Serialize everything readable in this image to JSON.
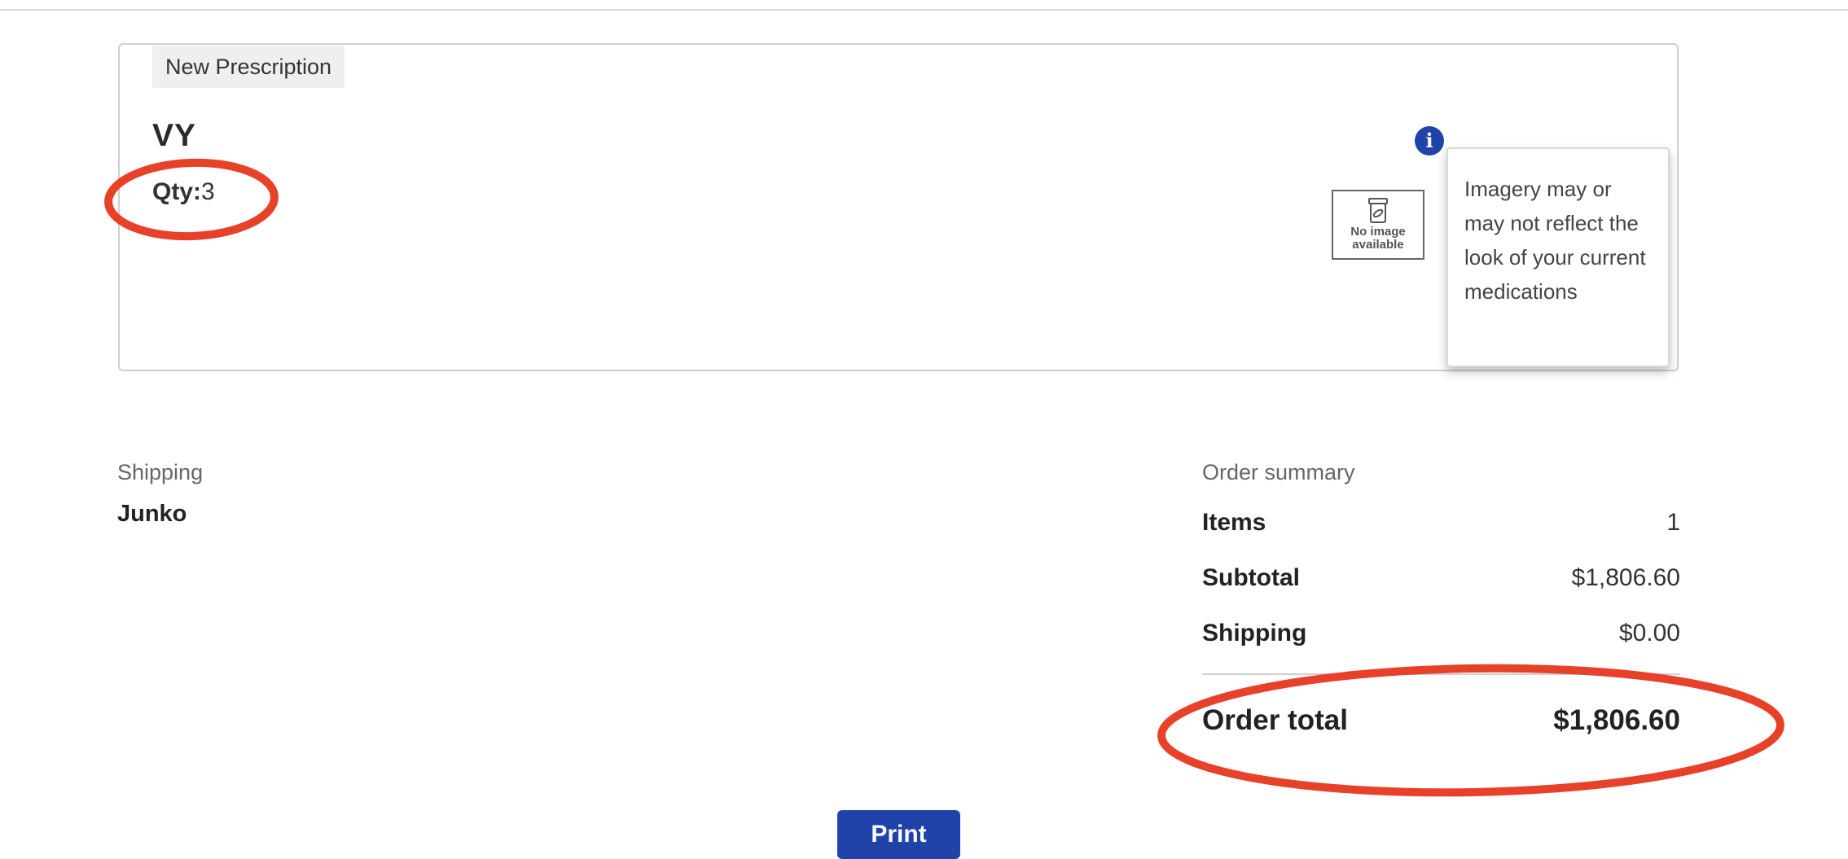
{
  "prescription": {
    "badge": "New Prescription",
    "name": "VY",
    "qty_label": "Qty:",
    "qty_value": "3",
    "image_placeholder": "No image available",
    "info_tooltip": "Imagery may or may not reflect the look of your current medications"
  },
  "shipping": {
    "label": "Shipping",
    "name": "Junko"
  },
  "order_summary": {
    "title": "Order summary",
    "rows": [
      {
        "label": "Items",
        "value": "1"
      },
      {
        "label": "Subtotal",
        "value": "$1,806.60"
      },
      {
        "label": "Shipping",
        "value": "$0.00"
      }
    ],
    "total_label": "Order total",
    "total_value": "$1,806.60"
  },
  "actions": {
    "print_label": "Print"
  },
  "colors": {
    "accent": "#1f43a8",
    "annotation": "#e8412a"
  },
  "icons": {
    "info": "info-icon",
    "no_image": "no-image-icon"
  }
}
